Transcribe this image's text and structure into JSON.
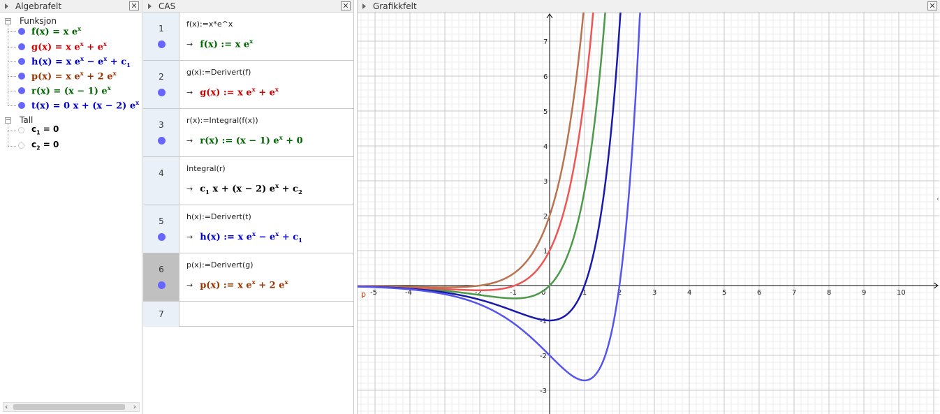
{
  "algebra": {
    "title": "Algebrafelt",
    "categories": [
      {
        "label": "Funksjon",
        "items": [
          {
            "html": "f(x) = x e<sup>x</sup>",
            "color": "#006600"
          },
          {
            "html": "g(x) = x e<sup>x</sup> + e<sup>x</sup>",
            "color": "#cc0000"
          },
          {
            "html": "h(x) = x e<sup>x</sup> &minus; e<sup>x</sup> + c<sub>1</sub>",
            "color": "#0000cc"
          },
          {
            "html": "p(x) = x e<sup>x</sup> + 2 e<sup>x</sup>",
            "color": "#993300"
          },
          {
            "html": "r(x) = (x &minus; 1) e<sup>x</sup>",
            "color": "#006600"
          },
          {
            "html": "t(x) = 0 x + (x &minus; 2) e<sup>x</sup>",
            "color": "#0000cc"
          }
        ]
      },
      {
        "label": "Tall",
        "items": [
          {
            "html": "c<sub>1</sub> = 0",
            "color": "#000000"
          },
          {
            "html": "c<sub>2</sub> = 0",
            "color": "#000000"
          }
        ]
      }
    ]
  },
  "cas": {
    "title": "CAS",
    "rows": [
      {
        "n": "1",
        "input": "f(x):=x*e^x",
        "output": "f(x) := x e<sup>x</sup>",
        "color": "#006600",
        "dot": true
      },
      {
        "n": "2",
        "input": "g(x):=Derivert(f)",
        "output": "g(x) := x e<sup>x</sup> + e<sup>x</sup>",
        "color": "#cc0000",
        "dot": true
      },
      {
        "n": "3",
        "input": "r(x):=Integral(f(x))",
        "output": "r(x) := (x &minus; 1) e<sup>x</sup> + 0",
        "color": "#006600",
        "dot": true
      },
      {
        "n": "4",
        "input": "Integral(r)",
        "output": "c<sub>1</sub> x + (x &minus; 2) e<sup>x</sup> + c<sub>2</sub>",
        "color": "#000000",
        "dot": false
      },
      {
        "n": "5",
        "input": "h(x):=Derivert(t)",
        "output": "h(x) := x e<sup>x</sup> &minus; e<sup>x</sup> + c<sub>1</sub>",
        "color": "#0000cc",
        "dot": true
      },
      {
        "n": "6",
        "input": "p(x):=Derivert(g)",
        "output": "p(x) := x e<sup>x</sup> + 2 e<sup>x</sup>",
        "color": "#993300",
        "dot": true
      }
    ],
    "empty_row": "7",
    "arrow": "→"
  },
  "graphics": {
    "title": "Grafikkfelt",
    "x_ticks": [
      "-5",
      "-4",
      "-3",
      "-2",
      "-1",
      "0",
      "1",
      "2",
      "3",
      "4",
      "5",
      "6",
      "7",
      "8",
      "9",
      "10"
    ],
    "y_ticks": [
      "7",
      "6",
      "5",
      "4",
      "3",
      "2",
      "1",
      "-1",
      "-2",
      "-3"
    ],
    "point_label": "p",
    "curve_colors": {
      "f": "#4c994c",
      "g": "#ee5555",
      "p": "#b87350",
      "h": "#1a1aaa",
      "t": "#5555ee"
    }
  },
  "close_symbol": "✕"
}
